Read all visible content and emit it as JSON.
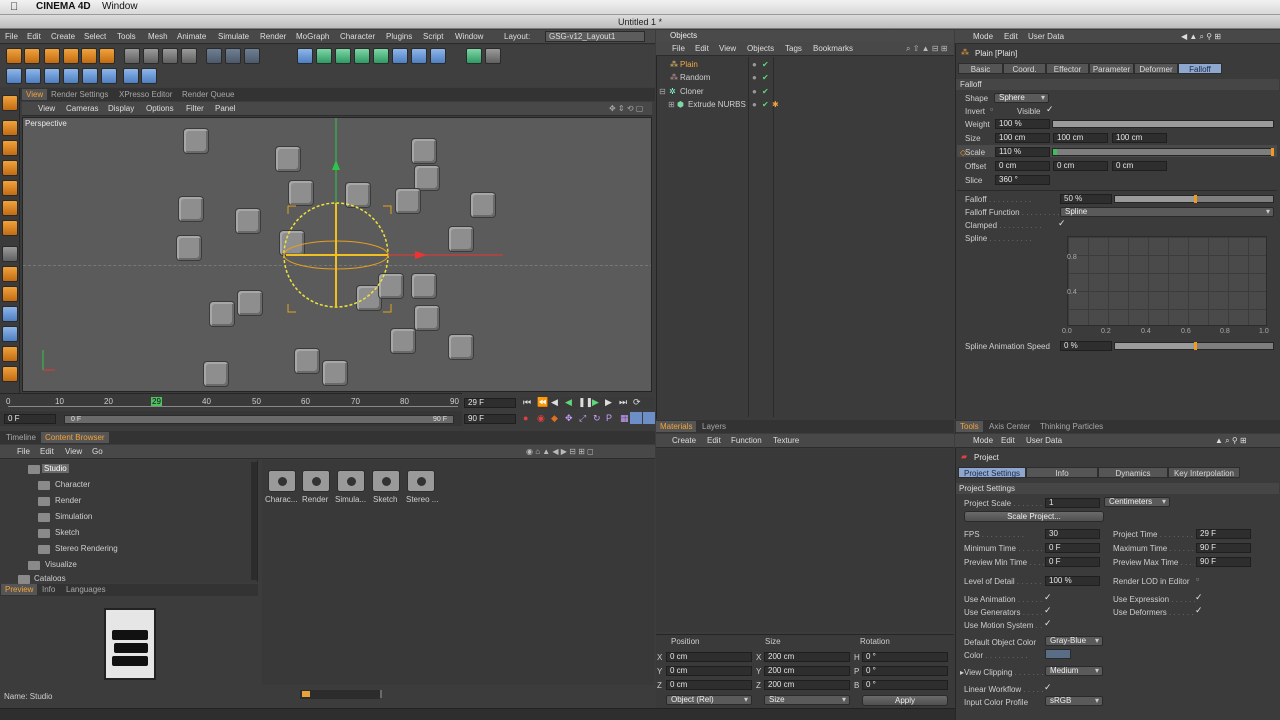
{
  "mac_menu": {
    "app": "CINEMA 4D",
    "window": "Window"
  },
  "window_title": "Untitled 1 *",
  "main_menu": [
    "File",
    "Edit",
    "Create",
    "Select",
    "Tools",
    "Mesh",
    "Animate",
    "Simulate",
    "Render",
    "MoGraph",
    "Character",
    "Plugins",
    "Script",
    "Window"
  ],
  "layout": {
    "label": "Layout:",
    "value": "GSG-v12_Layout1"
  },
  "view_tabs": [
    "View",
    "Render Settings",
    "XPresso Editor",
    "Render Queue"
  ],
  "viewport_menu": [
    "View",
    "Cameras",
    "Display",
    "Options",
    "Filter",
    "Panel"
  ],
  "viewport_label": "Perspective",
  "timeline": {
    "ticks": [
      "0",
      "10",
      "20",
      "29",
      "40",
      "50",
      "60",
      "70",
      "80",
      "90"
    ],
    "current_frame": "29 F",
    "end_frame": "90 F",
    "start_field": "0 F",
    "range_start": "0 F",
    "range_end": "90 F"
  },
  "browser_tabs": [
    "Timeline",
    "Content Browser"
  ],
  "browser_menu": [
    "File",
    "Edit",
    "View",
    "Go"
  ],
  "browser_tree": [
    "Studio",
    "Character",
    "Render",
    "Simulation",
    "Sketch",
    "Stereo Rendering",
    "Visualize",
    "Catalogs"
  ],
  "browser_items": [
    "Charac...",
    "Render",
    "Simula...",
    "Sketch",
    "Stereo ..."
  ],
  "preview_tabs": [
    "Preview",
    "Info",
    "Languages"
  ],
  "preview_name": "Name: Studio",
  "objects_panel": {
    "title": "Objects",
    "menu": [
      "File",
      "Edit",
      "View",
      "Objects",
      "Tags",
      "Bookmarks"
    ],
    "rows": [
      "Plain",
      "Random",
      "Cloner",
      "Extrude NURBS"
    ]
  },
  "materials_tabs": [
    "Materials",
    "Layers"
  ],
  "materials_menu": [
    "Create",
    "Edit",
    "Function",
    "Texture"
  ],
  "coords": {
    "headers": [
      "Position",
      "Size",
      "Rotation"
    ],
    "rows": [
      {
        "a": "X",
        "v1": "0 cm",
        "b": "X",
        "v2": "200 cm",
        "c": "H",
        "v3": "0 °"
      },
      {
        "a": "Y",
        "v1": "0 cm",
        "b": "Y",
        "v2": "200 cm",
        "c": "P",
        "v3": "0 °"
      },
      {
        "a": "Z",
        "v1": "0 cm",
        "b": "Z",
        "v2": "200 cm",
        "c": "B",
        "v3": "0 °"
      }
    ],
    "mode": "Object (Rel)",
    "size_mode": "Size",
    "apply": "Apply"
  },
  "attributes": {
    "menu": [
      "Mode",
      "Edit",
      "User Data"
    ],
    "object_name": "Plain [Plain]",
    "tabs": [
      "Basic",
      "Coord.",
      "Effector",
      "Parameter",
      "Deformer",
      "Falloff"
    ],
    "section": "Falloff",
    "shape_label": "Shape",
    "shape_value": "Sphere",
    "invert_label": "Invert",
    "visible_label": "Visible",
    "weight_label": "Weight",
    "weight_value": "100 %",
    "size_label": "Size",
    "size_values": [
      "100 cm",
      "100 cm",
      "100 cm"
    ],
    "scale_label": "Scale",
    "scale_value": "110 %",
    "offset_label": "Offset",
    "offset_values": [
      "0 cm",
      "0 cm",
      "0 cm"
    ],
    "slice_label": "Slice",
    "slice_value": "360 °",
    "falloff_label": "Falloff",
    "falloff_value": "50 %",
    "falloff_function_label": "Falloff Function",
    "falloff_function_value": "Spline",
    "clamped_label": "Clamped",
    "spline_label": "Spline",
    "spline_y_ticks": [
      "0.8",
      "0.4"
    ],
    "spline_x_ticks": [
      "0.0",
      "0.2",
      "0.4",
      "0.6",
      "0.8",
      "1.0"
    ],
    "spline_speed_label": "Spline Animation Speed",
    "spline_speed_value": "0 %"
  },
  "tools_tabs": [
    "Tools",
    "Axis Center",
    "Thinking Particles"
  ],
  "project": {
    "menu": [
      "Mode",
      "Edit",
      "User Data"
    ],
    "title": "Project",
    "tabs": [
      "Project Settings",
      "Info",
      "Dynamics",
      "Key Interpolation"
    ],
    "section": "Project Settings",
    "project_scale_label": "Project Scale",
    "project_scale_value": "1",
    "units": "Centimeters",
    "scale_project_btn": "Scale Project...",
    "fps_label": "FPS",
    "fps_value": "30",
    "project_time_label": "Project Time",
    "project_time_value": "29 F",
    "min_time_label": "Minimum Time",
    "min_time_value": "0 F",
    "max_time_label": "Maximum Time",
    "max_time_value": "90 F",
    "prev_min_label": "Preview Min Time",
    "prev_min_value": "0 F",
    "prev_max_label": "Preview Max Time",
    "prev_max_value": "90 F",
    "lod_label": "Level of Detail",
    "lod_value": "100 %",
    "render_lod_label": "Render LOD in Editor",
    "use_animation": "Use Animation",
    "use_expression": "Use Expression",
    "use_generators": "Use Generators",
    "use_deformers": "Use Deformers",
    "use_motion": "Use Motion System",
    "default_color_label": "Default Object Color",
    "default_color_value": "Gray-Blue",
    "color_label": "Color",
    "view_clipping_label": "View Clipping",
    "view_clipping_value": "Medium",
    "linear_workflow_label": "Linear Workflow",
    "input_profile_label": "Input Color Profile",
    "input_profile_value": "sRGB"
  }
}
